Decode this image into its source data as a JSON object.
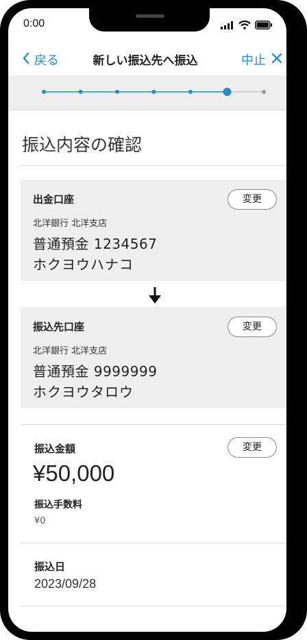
{
  "status_bar": {
    "time": "0:00"
  },
  "nav": {
    "back_label": "戻る",
    "title": "新しい振込先へ振込",
    "cancel_label": "中止"
  },
  "progress": {
    "total_steps": 7,
    "current_step": 6
  },
  "page": {
    "title": "振込内容の確認"
  },
  "source_account": {
    "label": "出金口座",
    "bank": "北洋銀行 北洋支店",
    "account": "普通預金 1234567",
    "holder": "ホクヨウハナコ",
    "change_label": "変更"
  },
  "destination_account": {
    "label": "振込先口座",
    "bank": "北洋銀行 北洋支店",
    "account": "普通預金 9999999",
    "holder": "ホクヨウタロウ",
    "change_label": "変更"
  },
  "amount": {
    "label": "振込金額",
    "value": "¥50,000",
    "change_label": "変更",
    "fee_label": "振込手数料",
    "fee_value": "¥0"
  },
  "transfer_date": {
    "label": "振込日",
    "value": "2023/09/28"
  },
  "colors": {
    "accent": "#1f8fcf",
    "card_bg": "#efefef",
    "progress_bg": "#efefef"
  }
}
